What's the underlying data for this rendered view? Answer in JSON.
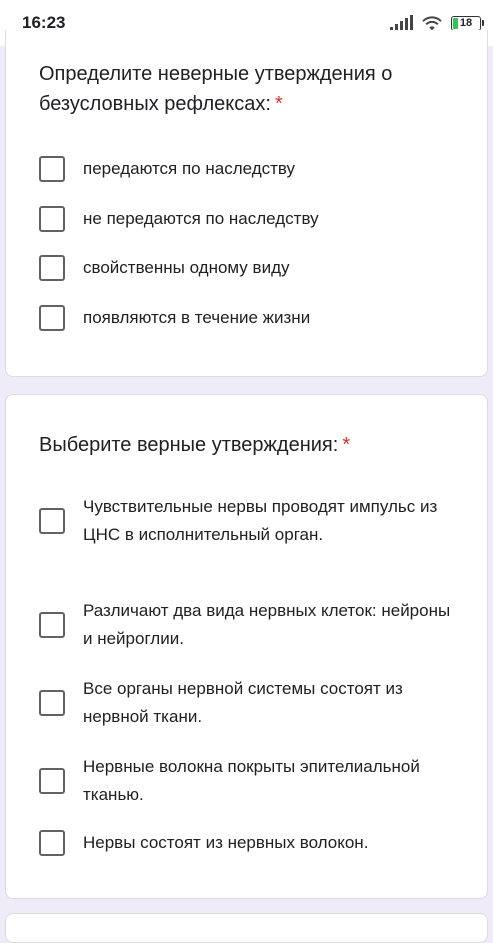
{
  "status_bar": {
    "time": "16:23",
    "battery": "18",
    "icons": [
      "signal-icon",
      "wifi-icon",
      "battery-icon"
    ]
  },
  "question1": {
    "text": "Определите неверные утверждения о безусловных рефлексах:",
    "required_mark": "*",
    "options": [
      "передаются по наследству",
      "не передаются по наследству",
      "свойственны одному виду",
      "появляются в течение жизни"
    ]
  },
  "question2": {
    "text": "Выберите верные утверждения:",
    "required_mark": "*",
    "options": [
      "Чувствительные нервы проводят импульс из ЦНС в исполнительный орган.",
      "Различают два вида нервных клеток: нейроны и нейроглии.",
      "Все органы нервной системы состоят из нервной ткани.",
      "Нервные волокна покрыты эпителиальной тканью.",
      "Нервы состоят из нервных волокон."
    ]
  },
  "colors": {
    "background": "#f0ebf8",
    "required": "#d93025",
    "checkbox_border": "#5f6368",
    "battery_fill": "#31c25a"
  }
}
